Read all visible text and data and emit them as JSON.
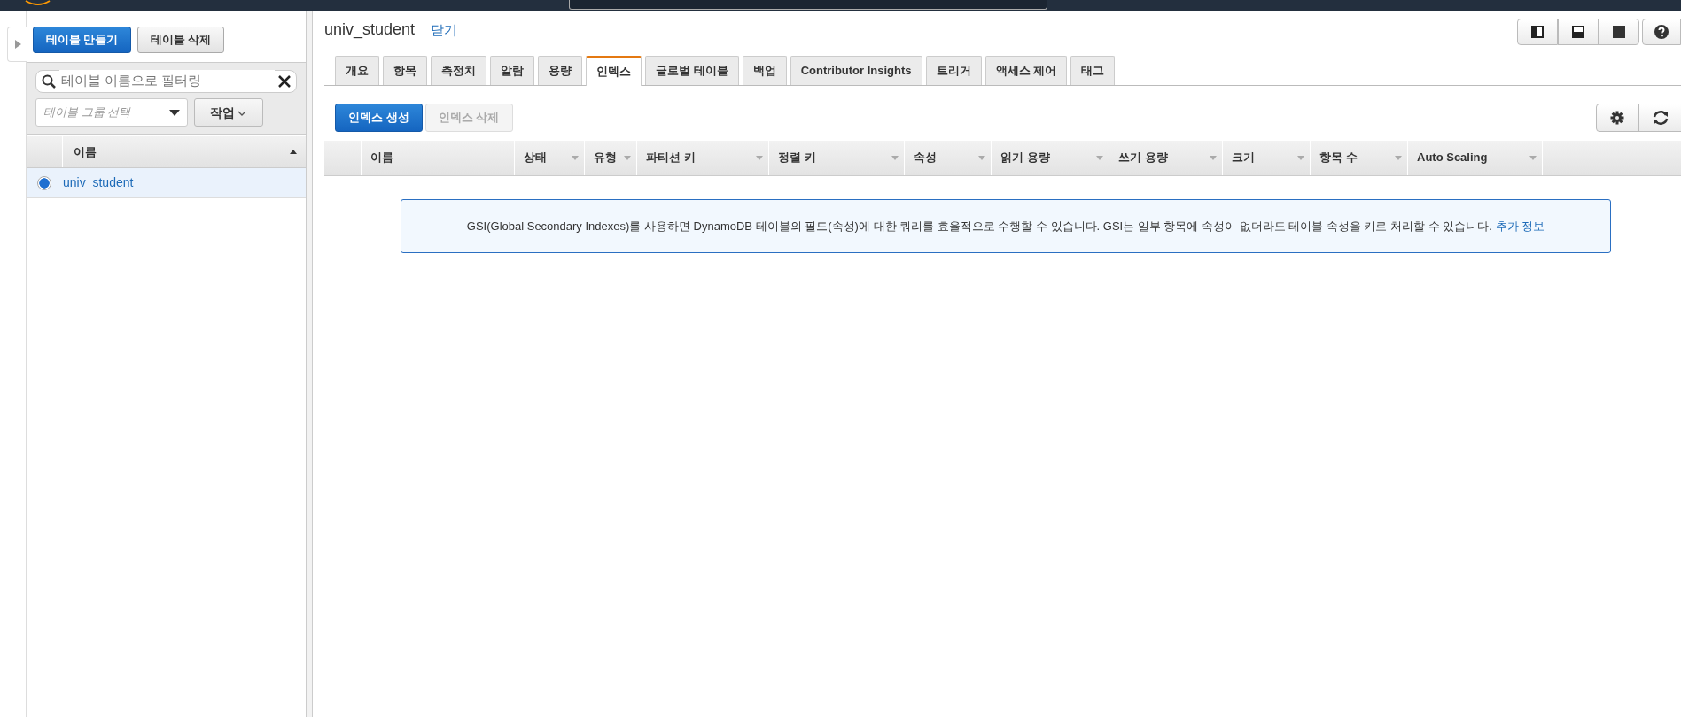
{
  "sidebar": {
    "buttons": [
      {
        "label": "테이블 만들기",
        "kind": "primary"
      },
      {
        "label": "테이블 삭제",
        "kind": "default"
      }
    ],
    "filter": {
      "placeholder": "테이블 이름으로 필터링"
    },
    "group_select": {
      "placeholder": "테이블 그룹 선택"
    },
    "actions_button": "작업",
    "table": {
      "column": "이름",
      "rows": [
        {
          "name": "univ_student",
          "selected": true
        }
      ]
    }
  },
  "main": {
    "title": "univ_student",
    "close_link": "닫기",
    "tabs": [
      {
        "label": "개요",
        "selected": false
      },
      {
        "label": "항목",
        "selected": false
      },
      {
        "label": "측정치",
        "selected": false
      },
      {
        "label": "알람",
        "selected": false
      },
      {
        "label": "용량",
        "selected": false
      },
      {
        "label": "인덱스",
        "selected": true
      },
      {
        "label": "글로벌 테이블",
        "selected": false
      },
      {
        "label": "백업",
        "selected": false
      },
      {
        "label": "Contributor Insights",
        "selected": false
      },
      {
        "label": "트리거",
        "selected": false
      },
      {
        "label": "액세스 제어",
        "selected": false
      },
      {
        "label": "태그",
        "selected": false
      }
    ],
    "buttons": [
      {
        "label": "인덱스 생성",
        "disabled": false
      },
      {
        "label": "인덱스 삭제",
        "disabled": true
      }
    ],
    "columns": [
      "이름",
      "상태",
      "유형",
      "파티션 키",
      "정렬 키",
      "속성",
      "읽기 용량",
      "쓰기 용량",
      "크기",
      "항목 수",
      "Auto Scaling"
    ],
    "info": {
      "text": "GSI(Global Secondary Indexes)를 사용하면 DynamoDB 테이블의 필드(속성)에 대한 쿼리를 효율적으로 수행할 수 있습니다. GSI는 일부 항목에 속성이 없더라도 테이블 속성을 키로 처리할 수 있습니다.",
      "link": "추가 정보"
    }
  }
}
